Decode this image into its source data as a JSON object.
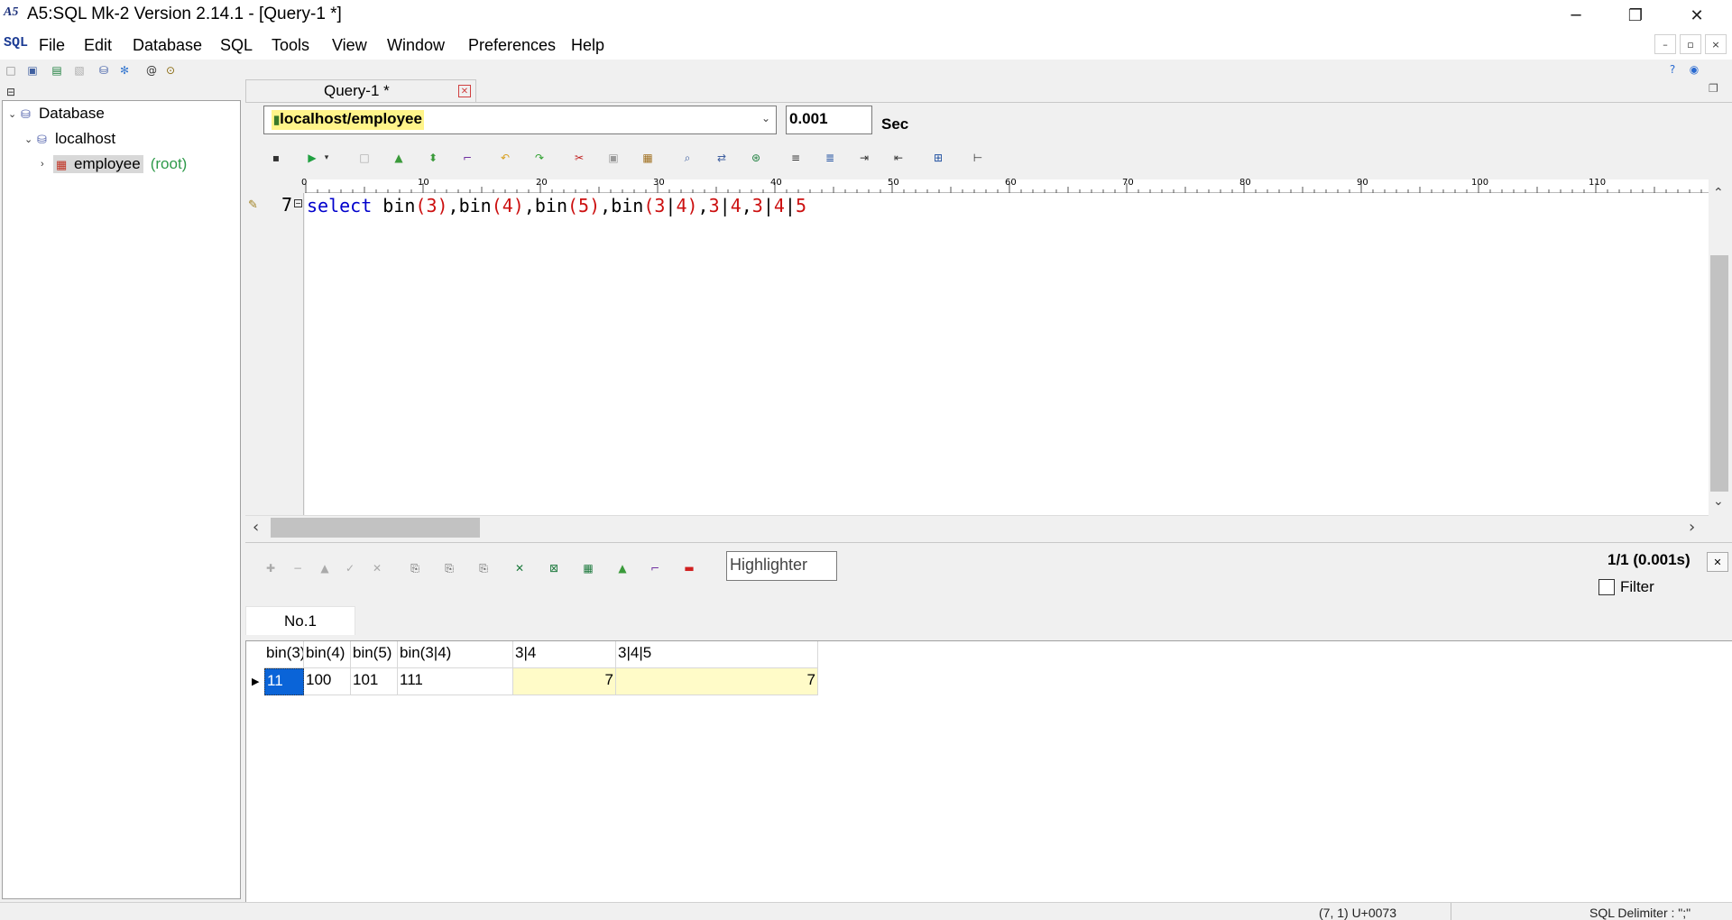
{
  "window": {
    "title": "A5:SQL Mk-2 Version 2.14.1 - [Query-1 *]",
    "minimize": "─",
    "restore": "❐",
    "close": "✕"
  },
  "menu": {
    "items": [
      "File",
      "Edit",
      "Database",
      "SQL",
      "Tools",
      "View",
      "Window",
      "Preferences",
      "Help"
    ],
    "mdi_min": "–",
    "mdi_restore": "▫",
    "mdi_close": "×"
  },
  "tree": {
    "root": "Database",
    "host": "localhost",
    "db": "employee",
    "db_user": "(root)"
  },
  "query": {
    "tab_label": "Query-1 *",
    "connection": "localhost/employee",
    "elapsed": "0.001",
    "elapsed_unit": "Sec",
    "line_number": "7",
    "ruler_labels": [
      "0",
      "10",
      "20",
      "30",
      "40",
      "50",
      "60",
      "70",
      "80",
      "90",
      "100",
      "110"
    ]
  },
  "result": {
    "highlighter_placeholder": "Highlighter",
    "count": "1/1 (0.001s)",
    "filter_label": "Filter",
    "tab_label": "No.1",
    "columns": [
      "bin(3)",
      "bin(4)",
      "bin(5)",
      "bin(3|4)",
      "3|4",
      "3|4|5"
    ],
    "rows": [
      [
        "11",
        "100",
        "101",
        "111",
        "7",
        "7"
      ]
    ]
  },
  "status": {
    "position": "(7, 1) U+0073",
    "delimiter": "SQL Delimiter : \";\""
  },
  "colors": {
    "keyword": "#0000cc",
    "number": "#cc1010",
    "highlight": "#fff48a",
    "selected_cell": "#0a64d8",
    "numeric_col": "#fffbc8"
  }
}
